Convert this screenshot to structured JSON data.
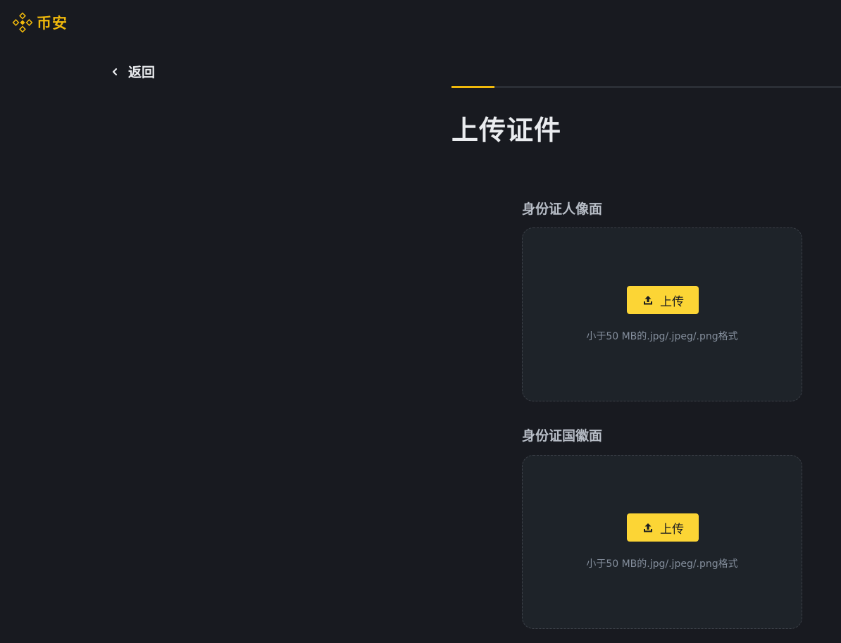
{
  "brand": {
    "name": "币安",
    "color": "#f0b90b"
  },
  "nav": {
    "back_label": "返回"
  },
  "progress": {
    "fraction": 0.11
  },
  "page": {
    "title": "上传证件"
  },
  "uploads": [
    {
      "label": "身份证人像面",
      "button_label": "上传",
      "hint": "小于50 MB的.jpg/.jpeg/.png格式",
      "icon": "upload-icon"
    },
    {
      "label": "身份证国徽面",
      "button_label": "上传",
      "hint": "小于50 MB的.jpg/.jpeg/.png格式",
      "icon": "upload-icon"
    }
  ],
  "colors": {
    "background": "#181a20",
    "panel": "#1e2329",
    "accent": "#fcd535"
  }
}
